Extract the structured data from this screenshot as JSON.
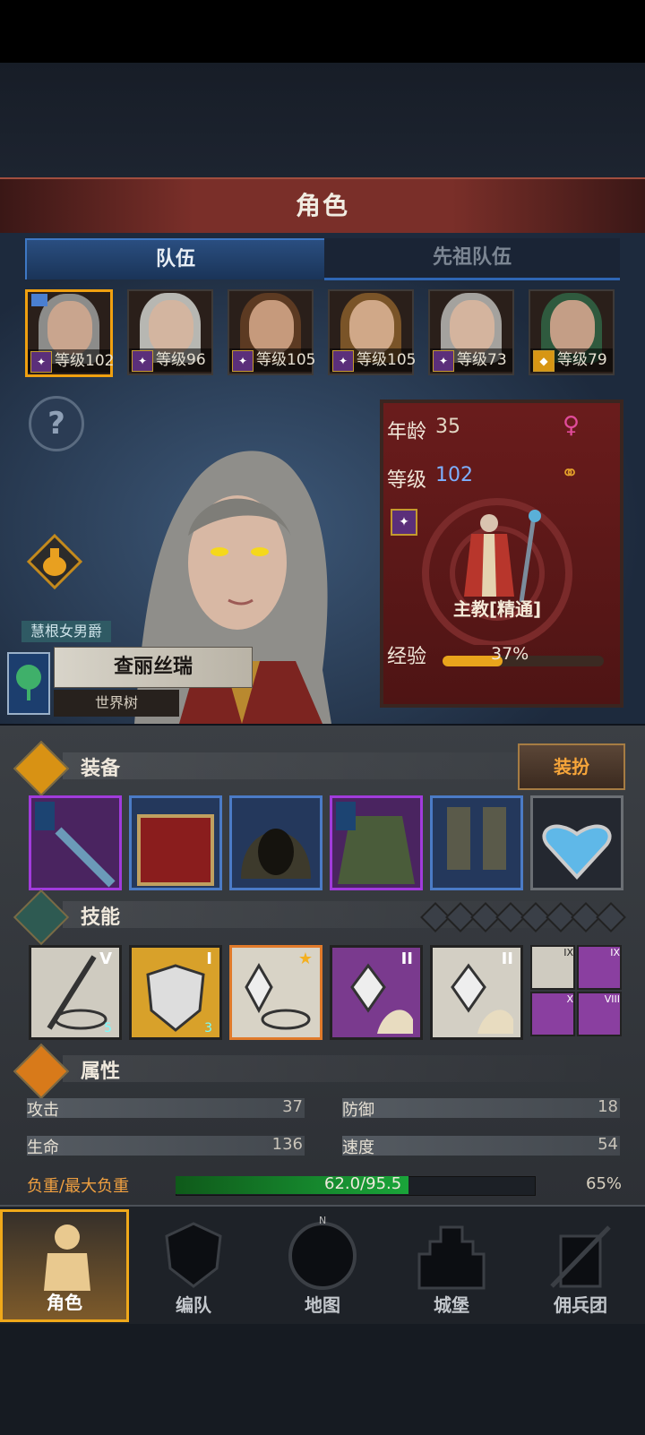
{
  "header": {
    "title": "角色"
  },
  "tabs": [
    {
      "label": "队伍"
    },
    {
      "label": "先祖队伍"
    }
  ],
  "party": [
    {
      "level_label": "等级102",
      "class_tier": "purple"
    },
    {
      "level_label": "等级96",
      "class_tier": "purple"
    },
    {
      "level_label": "等级105",
      "class_tier": "purple"
    },
    {
      "level_label": "等级105",
      "class_tier": "purple"
    },
    {
      "level_label": "等级73",
      "class_tier": "purple"
    },
    {
      "level_label": "等级79",
      "class_tier": "gold"
    }
  ],
  "character": {
    "title": "慧根女男爵",
    "name": "查丽丝瑞",
    "house": "世界树"
  },
  "info": {
    "age_label": "年龄",
    "age": "35",
    "level_label": "等级",
    "level": "102",
    "class_name": "主教[精通]",
    "exp_label": "经验",
    "exp_percent": "37%",
    "exp_fraction": 0.37
  },
  "equipment": {
    "label": "装备",
    "dress_button": "装扮",
    "slots": [
      {
        "icon": "staff-icon",
        "rarity": "purple"
      },
      {
        "icon": "book-icon",
        "rarity": "blue"
      },
      {
        "icon": "hood-icon",
        "rarity": "blue"
      },
      {
        "icon": "coat-icon",
        "rarity": "purple"
      },
      {
        "icon": "boots-icon",
        "rarity": "blue"
      },
      {
        "icon": "amulet-icon",
        "rarity": "gray"
      }
    ]
  },
  "skills": {
    "label": "技能",
    "items": [
      {
        "roman": "V",
        "badge": "5"
      },
      {
        "roman": "I",
        "badge": "3"
      },
      {
        "roman": "★",
        "badge": ""
      },
      {
        "roman": "II",
        "badge": ""
      },
      {
        "roman": "II",
        "badge": ""
      }
    ],
    "small": [
      "IX",
      "IX",
      "X",
      "VIII"
    ]
  },
  "attributes": {
    "label": "属性",
    "attack_label": "攻击",
    "attack": "37",
    "defense_label": "防御",
    "defense": "18",
    "hp_label": "生命",
    "hp": "136",
    "speed_label": "速度",
    "speed": "54",
    "weight_label": "负重/最大负重",
    "weight": "62.0/95.5",
    "weight_pct": "65%",
    "weight_fraction": 0.65
  },
  "nav": [
    {
      "label": "角色"
    },
    {
      "label": "编队"
    },
    {
      "label": "地图"
    },
    {
      "label": "城堡"
    },
    {
      "label": "佣兵团"
    }
  ],
  "colors": {
    "accent": "#f0a91a",
    "tab_blue": "#3e78c4",
    "exp_bar": "#e9a41c",
    "weight_bar": "#1aa53a"
  }
}
